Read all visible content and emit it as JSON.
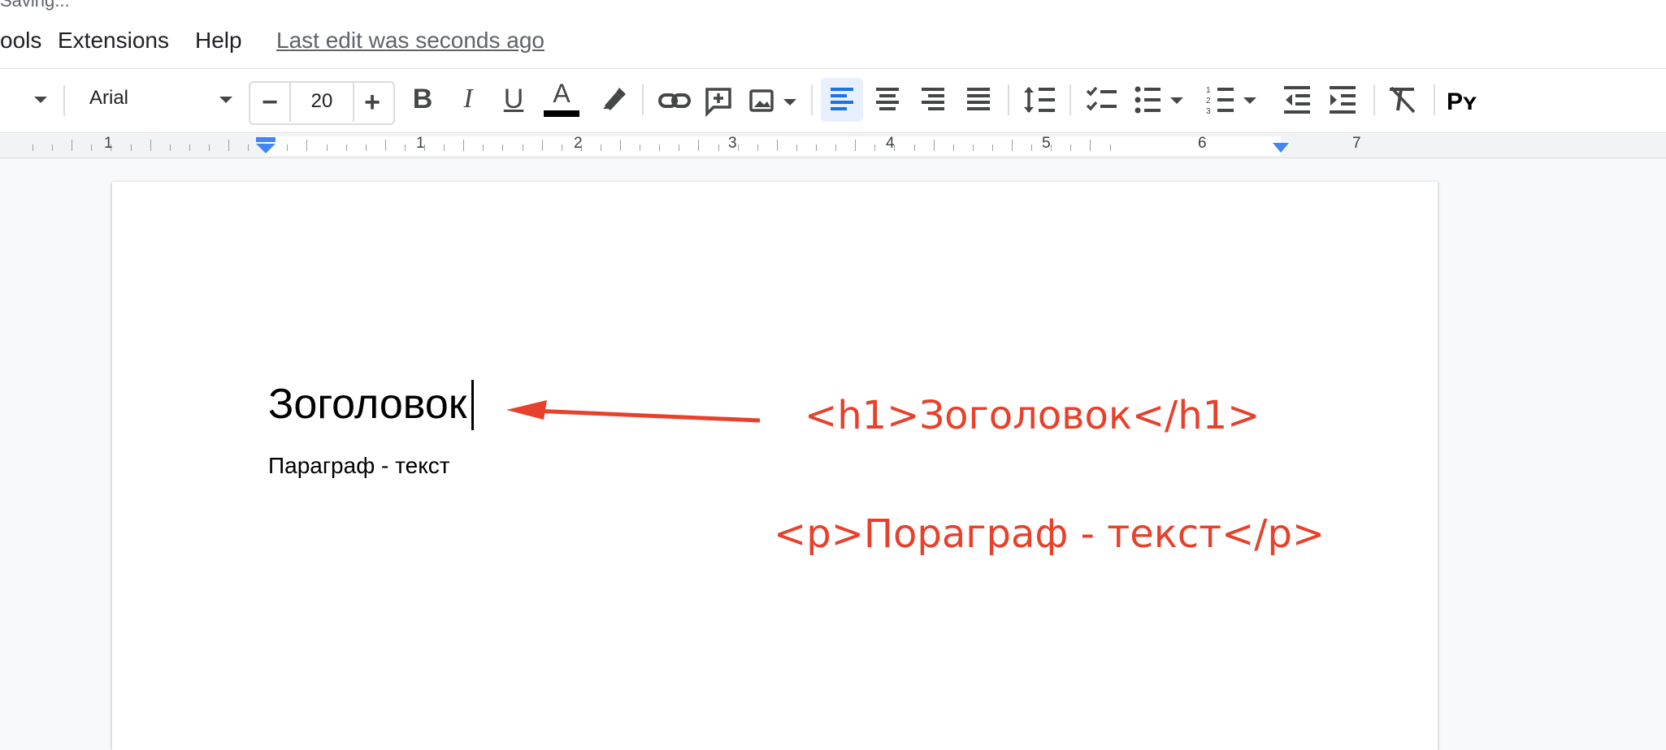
{
  "header": {
    "status": "Saving...",
    "menu": [
      "ools",
      "Extensions",
      "Help"
    ],
    "last_edit": "Last edit was seconds ago"
  },
  "toolbar": {
    "font_name": "Arial",
    "font_size": "20",
    "minus_label": "−",
    "plus_label": "+",
    "bold_label": "B",
    "italic_label": "I",
    "underline_label": "U",
    "text_color_label": "A",
    "text_color": "#000000",
    "input_tools_label": "Pʏ",
    "active_alignment": "left",
    "icons": [
      "chevron-down-icon",
      "highlighter-icon",
      "link-icon",
      "add-comment-icon",
      "image-icon",
      "align-left-icon",
      "align-center-icon",
      "align-right-icon",
      "align-justify-icon",
      "line-spacing-icon",
      "checklist-icon",
      "bulleted-list-icon",
      "numbered-list-icon",
      "decrease-indent-icon",
      "increase-indent-icon",
      "clear-formatting-icon"
    ]
  },
  "ruler": {
    "numbers": [
      "1",
      "1",
      "2",
      "3",
      "4",
      "5",
      "6",
      "7"
    ]
  },
  "document": {
    "heading": "Зоголовок",
    "paragraph": "Параграф - текст"
  },
  "annotations": {
    "h1_code": "<h1>Зоголовок</h1>",
    "p_code": "<p>Пораграф - текст</p>",
    "color": "#e8402a"
  }
}
